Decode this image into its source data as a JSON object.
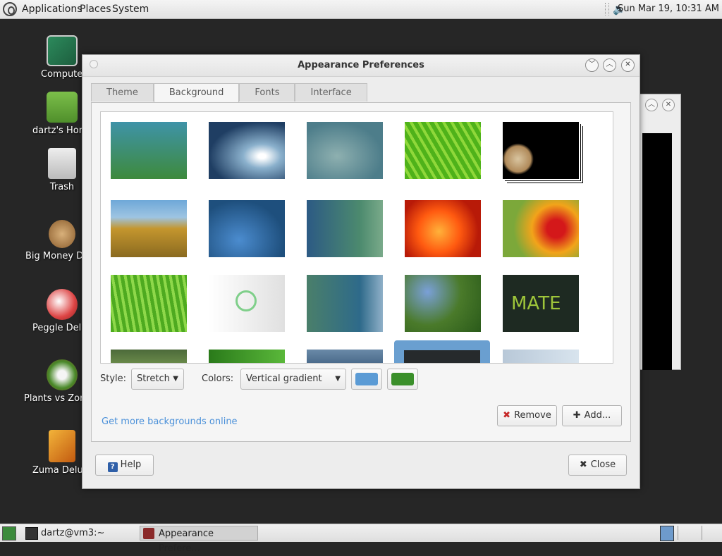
{
  "top_panel": {
    "menus": [
      "Applications",
      "Places",
      "System"
    ],
    "clock": "Sun Mar 19, 10:31 AM"
  },
  "desktop": {
    "icons": [
      {
        "label": "Computer",
        "icon": "computer-icon"
      },
      {
        "label": "dartz's Home",
        "icon": "home-folder-icon"
      },
      {
        "label": "Trash",
        "icon": "trash-icon"
      },
      {
        "label": "Big Money Deluxe",
        "icon": "money-bag-icon"
      },
      {
        "label": "Peggle Deluxe",
        "icon": "peggle-icon"
      },
      {
        "label": "Plants vs Zombies",
        "icon": "plants-icon"
      },
      {
        "label": "Zuma Deluxe",
        "icon": "zuma-icon"
      }
    ]
  },
  "window": {
    "title": "Appearance Preferences",
    "tabs": [
      "Theme",
      "Background",
      "Fonts",
      "Interface"
    ],
    "active_tab": "Background",
    "thumbnail_overlay_text": "MATE",
    "style_label": "Style:",
    "style_value": "Stretch",
    "colors_label": "Colors:",
    "colors_value": "Vertical gradient",
    "color_1": "#5b9bd5",
    "color_2": "#3a8f2a",
    "more_link": "Get more backgrounds online",
    "remove_label": "Remove",
    "add_label": "Add...",
    "help_label": "Help",
    "close_label": "Close"
  },
  "taskbar": {
    "tasks": [
      "dartz@vm3:~",
      "Appearance Prefere..."
    ]
  }
}
